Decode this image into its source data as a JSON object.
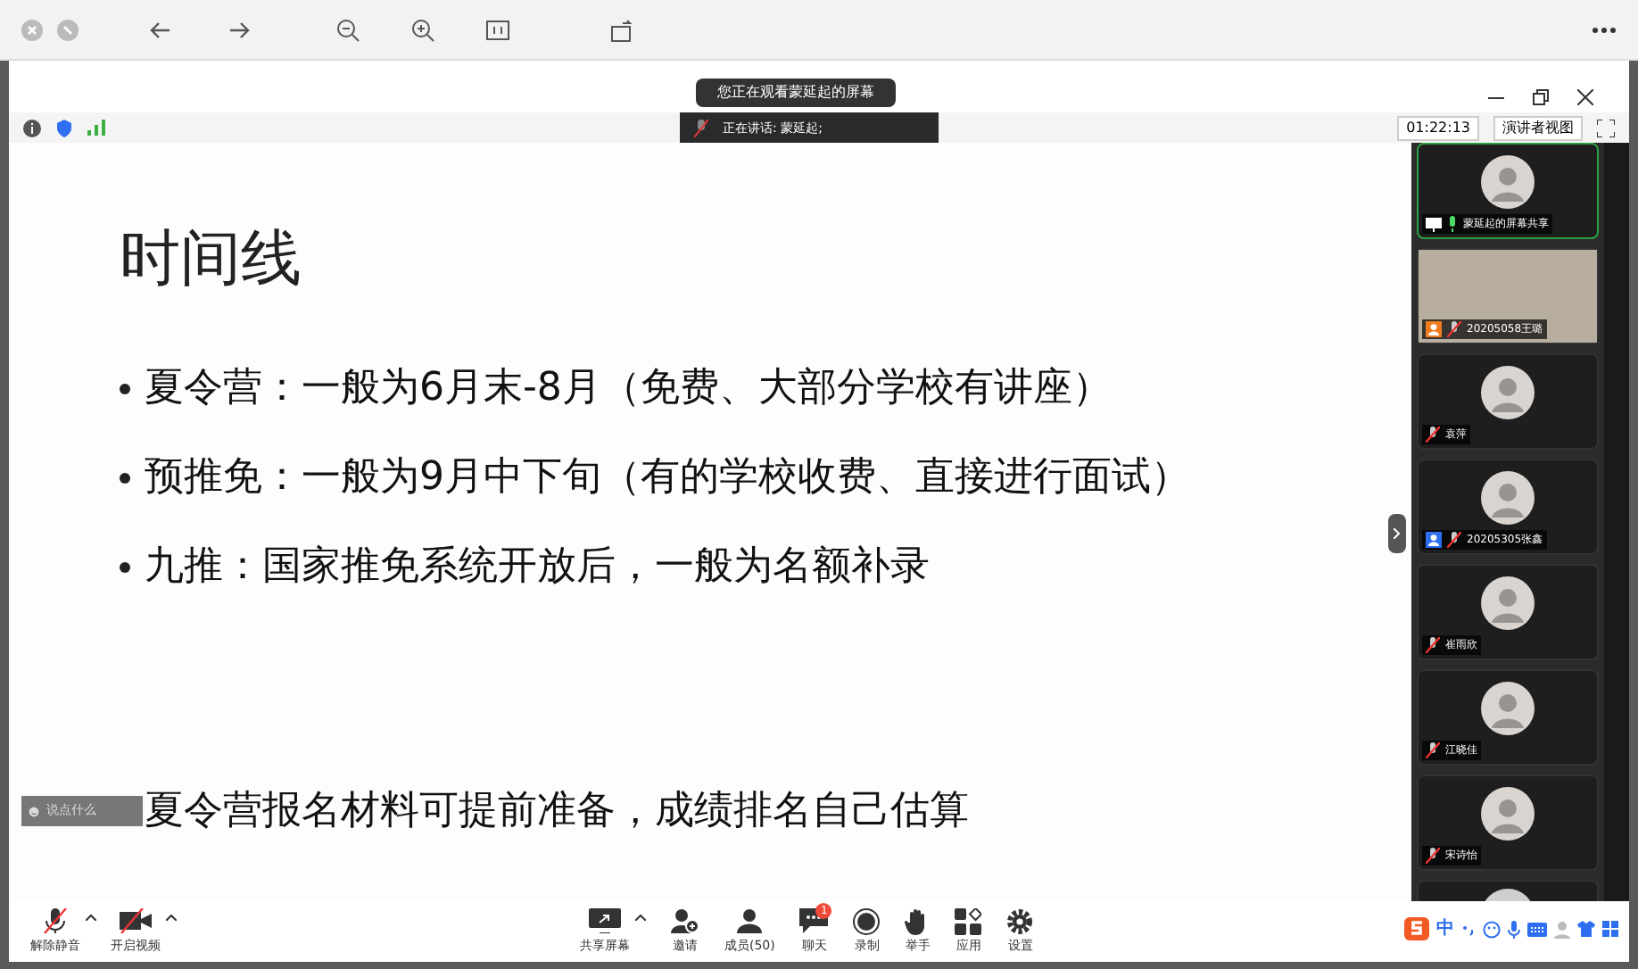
{
  "notice": "您正在观看蒙延起的屏幕",
  "speaker": "正在讲话: 蒙延起;",
  "timer": "01:22:13",
  "view_button": "演讲者视图",
  "slide": {
    "title": "时间线",
    "bullets": [
      "夏令营：一般为6月末-8月（免费、大部分学校有讲座）",
      "预推免：一般为9月中下旬（有的学校收费、直接进行面试）",
      "九推：国家推免系统开放后，一般为名额补录"
    ],
    "footer": "夏令营报名材料可提前准备，成绩排名自己估算"
  },
  "chat_input": {
    "placeholder": "说点什么"
  },
  "participants": [
    {
      "name": "蒙延起的屏幕共享",
      "kind": "avatar",
      "badge": {
        "kind": "screen"
      },
      "muted": false,
      "selected": true
    },
    {
      "name": "20205058王璐",
      "kind": "video",
      "badge": {
        "kind": "person",
        "color": "#f07c1e"
      },
      "muted": true,
      "selected": false
    },
    {
      "name": "袁萍",
      "kind": "avatar",
      "muted": true,
      "selected": false
    },
    {
      "name": "20205305张鑫",
      "kind": "avatar",
      "badge": {
        "kind": "person",
        "color": "#2d6ff0"
      },
      "muted": true,
      "selected": false
    },
    {
      "name": "崔雨欣",
      "kind": "avatar",
      "muted": true,
      "selected": false
    },
    {
      "name": "江晓佳",
      "kind": "avatar",
      "muted": true,
      "selected": false
    },
    {
      "name": "宋诗怡",
      "kind": "avatar",
      "muted": true,
      "selected": false
    }
  ],
  "toolbar_left": [
    {
      "label": "解除静音",
      "kind": "mic",
      "menu": true
    },
    {
      "label": "开启视频",
      "kind": "camera",
      "menu": true
    }
  ],
  "toolbar_center": [
    {
      "label": "共享屏幕",
      "kind": "share",
      "menu": true
    },
    {
      "label": "邀请",
      "kind": "invite",
      "menu": false
    },
    {
      "label": "成员(50)",
      "kind": "members",
      "menu": false
    },
    {
      "label": "聊天",
      "kind": "chat",
      "menu": false,
      "badge": "1"
    },
    {
      "label": "录制",
      "kind": "record",
      "menu": false
    },
    {
      "label": "举手",
      "kind": "hand",
      "menu": false
    },
    {
      "label": "应用",
      "kind": "apps",
      "menu": false
    },
    {
      "label": "设置",
      "kind": "settings",
      "menu": false
    }
  ],
  "ime_bar": {
    "mode": "中"
  }
}
